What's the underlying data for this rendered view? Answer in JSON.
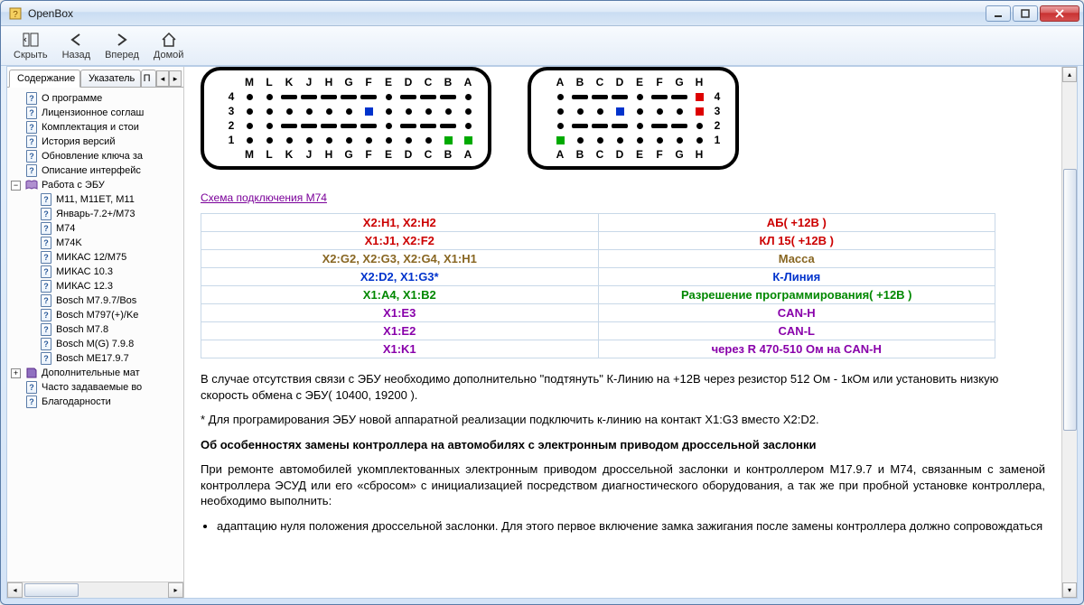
{
  "window": {
    "title": "OpenBox"
  },
  "toolbar": {
    "hide": "Скрыть",
    "back": "Назад",
    "forward": "Вперед",
    "home": "Домой"
  },
  "tabs": {
    "contents": "Содержание",
    "index": "Указатель",
    "search": "П"
  },
  "tree": {
    "about": "О программе",
    "license": "Лицензионное соглаш",
    "bundle": "Комплектация и стои",
    "history": "История версий",
    "keyupdate": "Обновление ключа за",
    "interface": "Описание интерфейс",
    "ecu": "Работа с ЭБУ",
    "m11": "M11, M11ET, M11",
    "january": "Январь-7.2+/M73",
    "m74": "M74",
    "m74k": "M74K",
    "mikas12": "МИКАС 12/M75",
    "mikas103": "МИКАС 10.3",
    "mikas123": "МИКАС 12.3",
    "bosch797": "Bosch M7.9.7/Bos",
    "bosch797ke": "Bosch M797(+)/Ke",
    "bosch78": "Bosch M7.8",
    "boschmg": "Bosch M(G) 7.9.8",
    "boschme": "Bosch ME17.9.7",
    "extras": "Дополнительные мат",
    "faq": "Часто задаваемые во",
    "thanks": "Благодарности"
  },
  "content": {
    "conn_labels_left": [
      "M",
      "L",
      "K",
      "J",
      "H",
      "G",
      "F",
      "E",
      "D",
      "C",
      "B",
      "A"
    ],
    "conn_labels_right": [
      "A",
      "B",
      "C",
      "D",
      "E",
      "F",
      "G",
      "H"
    ],
    "row_labels": [
      "4",
      "3",
      "2",
      "1"
    ],
    "schema_link": "Схема подключения M74",
    "table": [
      {
        "pins": "X2:H1, X2:H2",
        "desc": "АБ( +12В )",
        "cls": "c-red"
      },
      {
        "pins": "X1:J1, X2:F2",
        "desc": "КЛ 15( +12В )",
        "cls": "c-red"
      },
      {
        "pins": "X2:G2, X2:G3, X2:G4, X1:H1",
        "desc": "Масса",
        "cls": "c-brown"
      },
      {
        "pins": "X2:D2, X1:G3*",
        "desc": "К-Линия",
        "cls": "c-blue"
      },
      {
        "pins": "X1:A4, X1:B2",
        "desc": "Разрешение программирования( +12В )",
        "cls": "c-green"
      },
      {
        "pins": "X1:E3",
        "desc": "CAN-H",
        "cls": "c-purple"
      },
      {
        "pins": "X1:E2",
        "desc": "CAN-L",
        "cls": "c-purple"
      },
      {
        "pins": "X1:K1",
        "desc": "через R 470-510 Ом на CAN-H",
        "cls": "c-purple"
      }
    ],
    "para1": "В случае отсутствия связи с ЭБУ необходимо дополнительно \"подтянуть\" К-Линию на +12В через резистор 512 Ом - 1кОм или установить низкую скорость обмена с ЭБУ( 10400, 19200 ).",
    "para2": "* Для програмирования ЭБУ новой аппаратной реализации подключить к-линию на контакт X1:G3 вместо X2:D2.",
    "heading": "Об особенностях замены контроллера на автомобилях с электронным приводом дроссельной заслонки",
    "para3": "При ремонте автомобилей укомплектованных электронным приводом дроссельной заслонки и контроллером M17.9.7 и M74, связанным с заменой контроллера ЭСУД или его «сбросом» с инициализацией посредством диагностического оборудования, а так же при пробной установке контроллера, необходимо выполнить:",
    "li1": "адаптацию нуля положения дроссельной заслонки. Для этого первое включение замка зажигания после замены контроллера должно сопровождаться"
  }
}
